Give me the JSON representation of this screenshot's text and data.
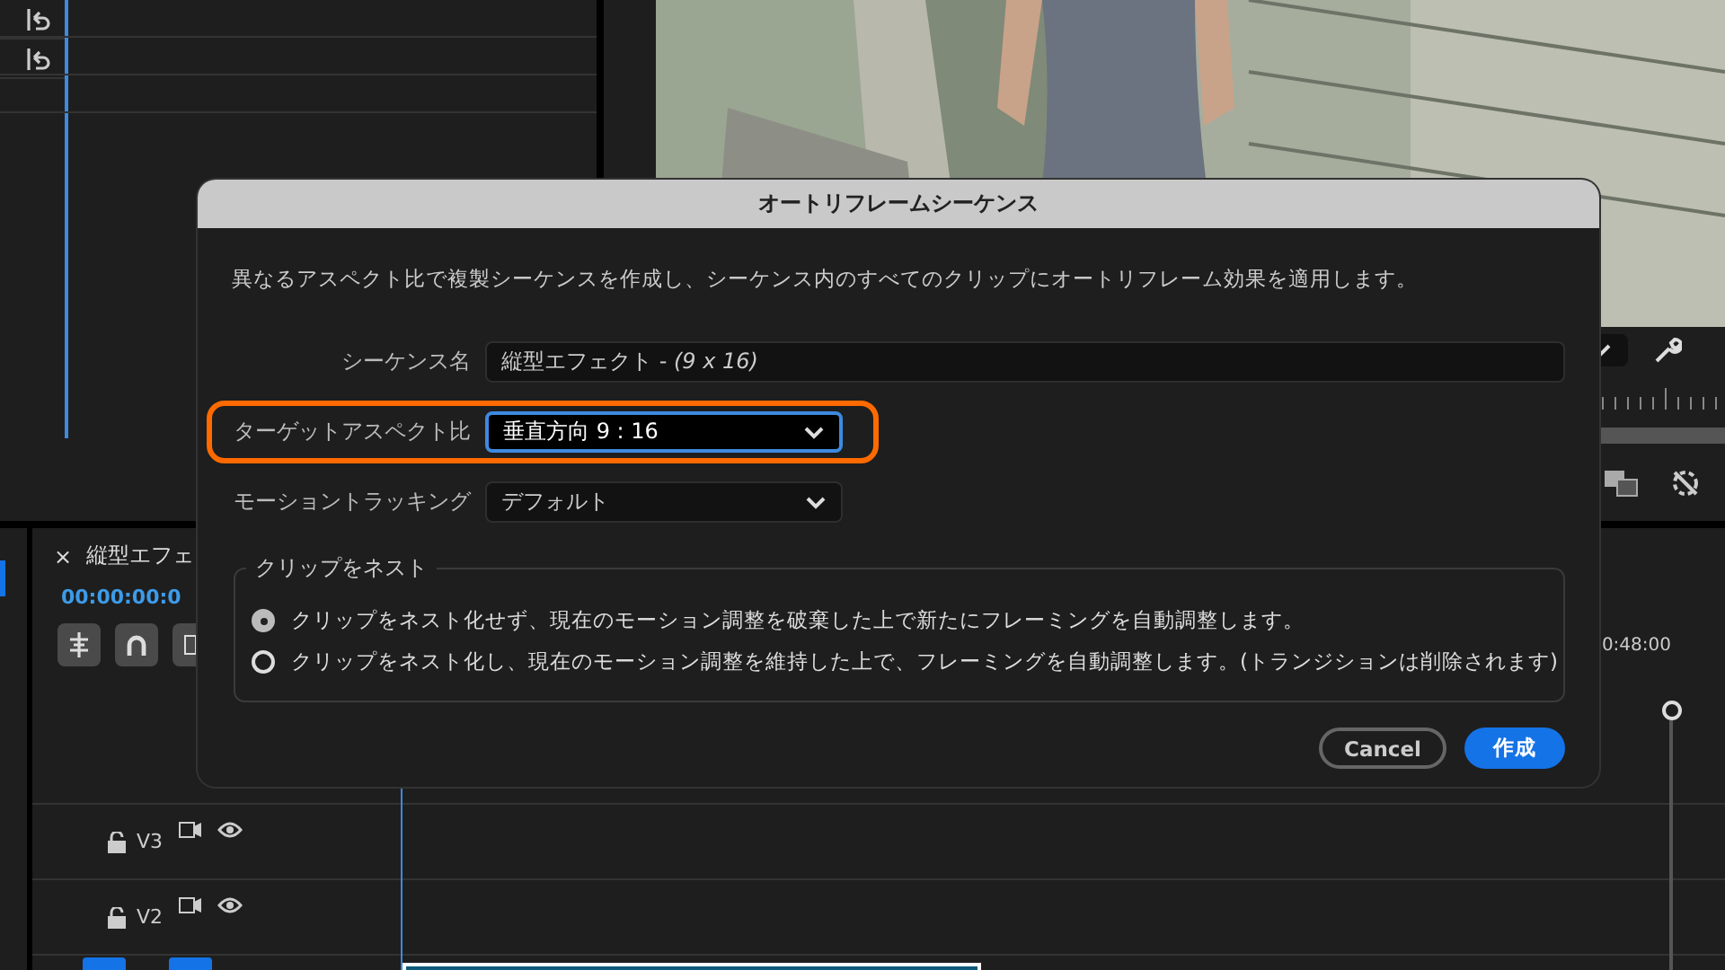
{
  "timeline": {
    "close_icon": "×",
    "tab_title": "縦型エフェ",
    "timecode": "00:00:00:0",
    "ruler_time": "0:48:00",
    "tracks": [
      {
        "name": "V3"
      },
      {
        "name": "V2"
      }
    ]
  },
  "dialog": {
    "title": "オートリフレームシーケンス",
    "description": "異なるアスペクト比で複製シーケンスを作成し、シーケンス内のすべてのクリップにオートリフレーム効果を適用します。",
    "fields": [
      {
        "kind": "text",
        "label": "シーケンス名",
        "value": "縦型エフェクト - *(9 x 16)*",
        "highlighted": false,
        "focused": false
      },
      {
        "kind": "select",
        "label": "ターゲットアスペクト比",
        "value": "垂直方向 9 : 16",
        "highlighted": true,
        "focused": true
      },
      {
        "kind": "select",
        "label": "モーショントラッキング",
        "value": "デフォルト",
        "highlighted": false,
        "focused": false
      }
    ],
    "nest_group": {
      "legend": "クリップをネスト",
      "options": [
        {
          "label": "クリップをネスト化せず、現在のモーション調整を破棄した上で新たにフレーミングを自動調整します。",
          "selected": true
        },
        {
          "label": "クリップをネスト化し、現在のモーション調整を維持した上で、フレーミングを自動調整します。(トランジションは削除されます)",
          "selected": false
        }
      ]
    },
    "buttons": [
      {
        "kind": "secondary",
        "label": "Cancel"
      },
      {
        "kind": "primary",
        "label": "作成"
      }
    ]
  }
}
